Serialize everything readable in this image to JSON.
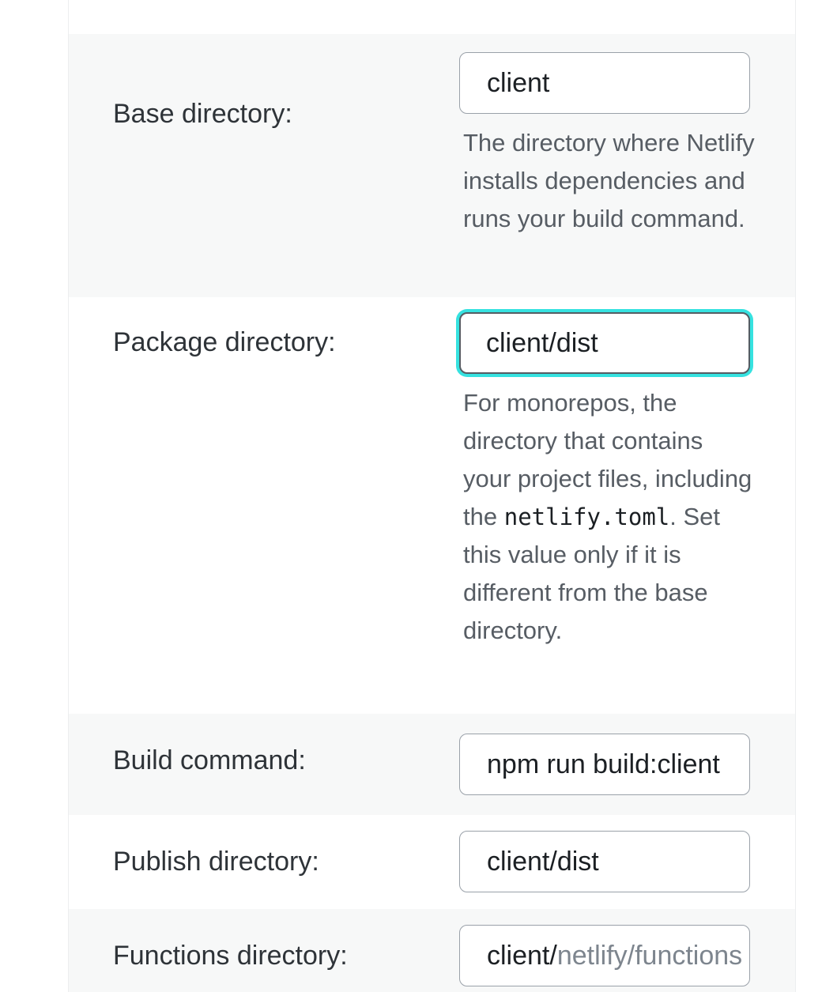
{
  "fields": {
    "base": {
      "label": "Base directory:",
      "value": "client",
      "help": "The directory where Netlify installs dependencies and runs your build command."
    },
    "package": {
      "label": "Package directory:",
      "value": "client/dist",
      "help_before": "For monorepos, the directory that contains your project files, including the",
      "help_code": "netlify.toml",
      "help_after": ". Set this value only if it is different from the base directory."
    },
    "build": {
      "label": "Build command:",
      "value": "npm run build:client"
    },
    "publish": {
      "label": "Publish directory:",
      "value": "client/dist"
    },
    "functions": {
      "label": "Functions directory:",
      "prefix": "client/",
      "placeholder": "netlify/functions"
    }
  }
}
